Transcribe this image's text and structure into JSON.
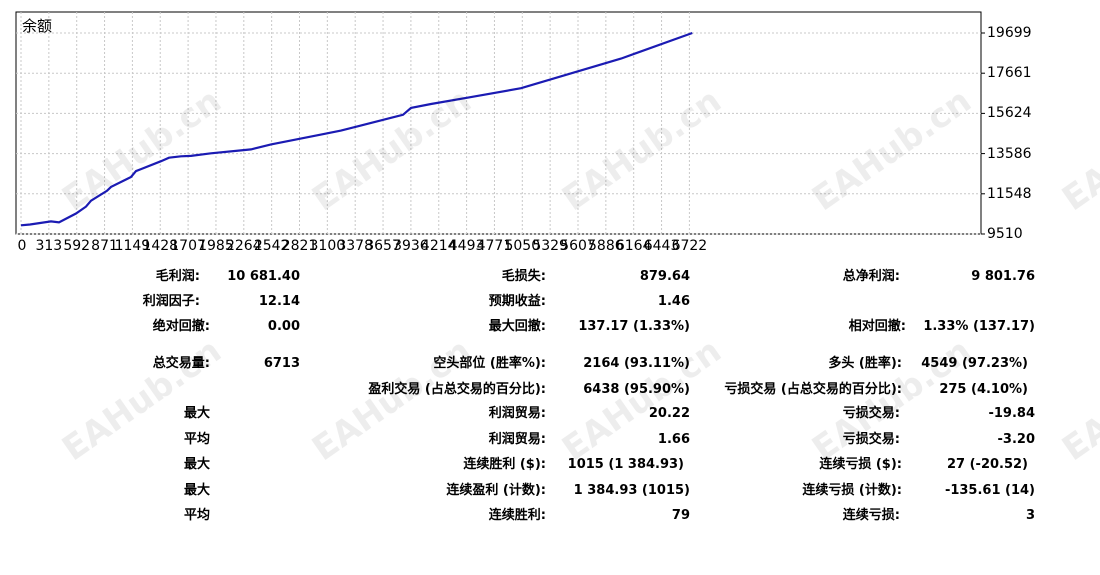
{
  "chart_data": {
    "type": "line",
    "title": "余额",
    "xlabel": "",
    "ylabel": "",
    "x_ticks": [
      "0",
      "313",
      "592",
      "871",
      "1149",
      "1428",
      "1707",
      "1985",
      "2264",
      "2542",
      "2821",
      "3100",
      "3378",
      "3657",
      "3936",
      "4214",
      "4493",
      "4771",
      "5050",
      "5329",
      "5607",
      "5886",
      "6164",
      "6443",
      "6722"
    ],
    "y_ticks": [
      "19699",
      "17661",
      "15624",
      "13586",
      "11548",
      "9510"
    ],
    "xlim": [
      0,
      6713
    ],
    "ylim": [
      9510,
      20500
    ],
    "grid": true,
    "series": [
      {
        "color": "#1b1bb3",
        "x": [
          0,
          90,
          300,
          380,
          550,
          650,
          700,
          860,
          900,
          1100,
          1150,
          1200,
          1400,
          1480,
          1600,
          1700,
          1900,
          2200,
          2300,
          2500,
          3000,
          3200,
          3700,
          3820,
          3900,
          4100,
          4500,
          5000,
          6000,
          6713
        ],
        "y": [
          9950,
          9990,
          10150,
          10100,
          10550,
          10900,
          11200,
          11700,
          11900,
          12400,
          12700,
          12800,
          13200,
          13380,
          13450,
          13470,
          13600,
          13750,
          13800,
          14050,
          14550,
          14750,
          15400,
          15550,
          15900,
          16100,
          16450,
          16900,
          18400,
          19700
        ]
      }
    ]
  },
  "watermark": "EAHub.cn",
  "stats": [
    {
      "label": "毛利润:",
      "value": "10 681.40"
    },
    {
      "label": "毛损失:",
      "value": "879.64"
    },
    {
      "label": "总净利润:",
      "value": "9 801.76"
    },
    {
      "label": "利润因子:",
      "value": "12.14"
    },
    {
      "label": "预期收益:",
      "value": "1.46"
    },
    {
      "label": "绝对回撤:",
      "value": "0.00"
    },
    {
      "label": "最大回撤:",
      "value": "137.17 (1.33%)"
    },
    {
      "label": "相对回撤:",
      "value": "1.33% (137.17)"
    },
    {
      "label": "总交易量:",
      "value": "6713"
    },
    {
      "label": "空头部位 (胜率%):",
      "value": "2164 (93.11%)"
    },
    {
      "label": "多头 (胜率):",
      "value": "4549 (97.23%)"
    },
    {
      "label": "盈利交易 (占总交易的百分比):",
      "value": "6438 (95.90%)"
    },
    {
      "label": "亏损交易 (占总交易的百分比):",
      "value": "275 (4.10%)"
    },
    {
      "label": "最大",
      "value": ""
    },
    {
      "label": "利润贸易:",
      "value": "20.22"
    },
    {
      "label": "亏损交易:",
      "value": "-19.84"
    },
    {
      "label": "平均",
      "value": ""
    },
    {
      "label": "利润贸易:",
      "value": "1.66"
    },
    {
      "label": "亏损交易:",
      "value": "-3.20"
    },
    {
      "label": "最大",
      "value": ""
    },
    {
      "label": "连续胜利 ($):",
      "value": "1015 (1 384.93)"
    },
    {
      "label": "连续亏损 ($):",
      "value": "27 (-20.52)"
    },
    {
      "label": "最大",
      "value": ""
    },
    {
      "label": "连续盈利 (计数):",
      "value": "1 384.93 (1015)"
    },
    {
      "label": "连续亏损 (计数):",
      "value": "-135.61 (14)"
    },
    {
      "label": "平均",
      "value": ""
    },
    {
      "label": "连续胜利:",
      "value": "79"
    },
    {
      "label": "连续亏损:",
      "value": "3"
    }
  ]
}
